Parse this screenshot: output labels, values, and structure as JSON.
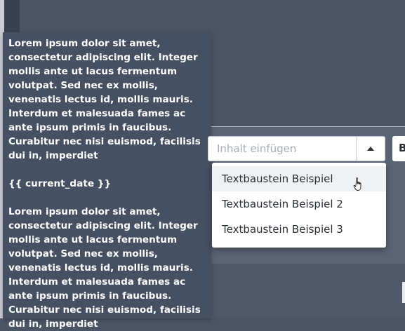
{
  "tooltip": {
    "paragraph_1": "Lorem ipsum dolor sit amet, consectetur adipiscing elit. Integer mollis ante ut lacus fermentum volutpat. Sed nec ex mollis, venenatis lectus id, mollis mauris. Interdum et malesuada fames ac ante ipsum primis in faucibus. Curabitur nec nisi euismod, facilisis dui in, imperdiet",
    "placeholder_tag": "{{ current_date }}",
    "paragraph_2": "Lorem ipsum dolor sit amet, consectetur adipiscing elit. Integer mollis ante ut lacus fermentum volutpat. Sed nec ex mollis, venenatis lectus id, mollis mauris. Interdum et malesuada fames ac ante ipsum primis in faucibus. Curabitur nec nisi euismod, facilisis dui in, imperdiet"
  },
  "select": {
    "placeholder": "Inhalt einfügen",
    "next_field_text": "B"
  },
  "dropdown": {
    "items": [
      {
        "label": "Textbaustein Beispiel"
      },
      {
        "label": "Textbaustein Beispiel 2"
      },
      {
        "label": "Textbaustein Beispiel 3"
      }
    ]
  },
  "icons": {
    "caret": "caret-up-icon",
    "cursor": "hand-pointer-icon"
  }
}
